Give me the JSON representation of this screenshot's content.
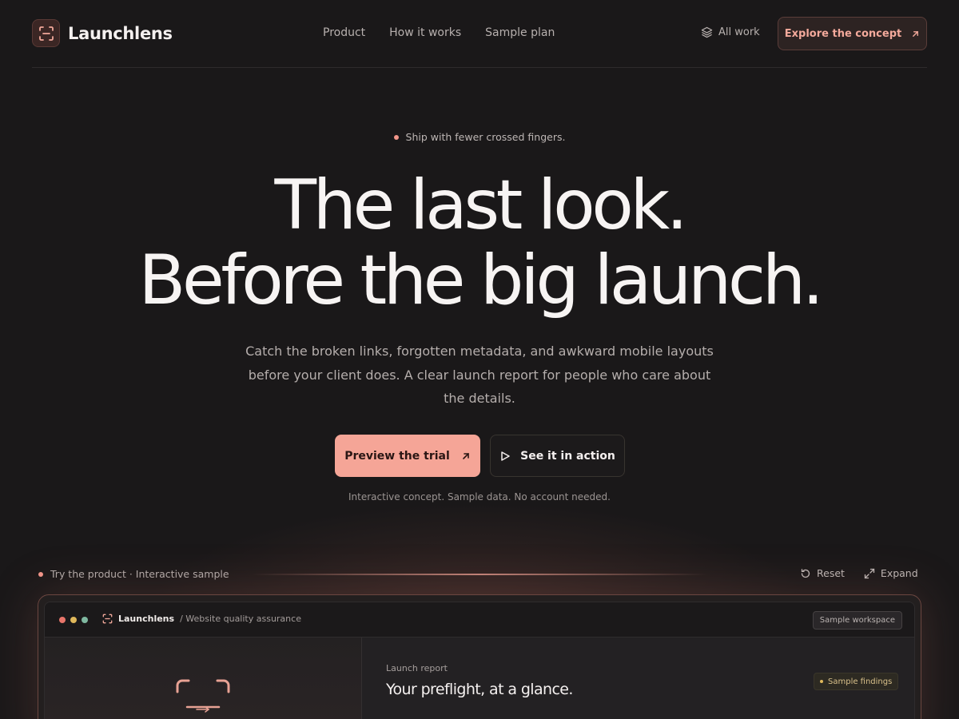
{
  "brand": {
    "name": "Launchlens"
  },
  "nav": {
    "links": [
      "Product",
      "How it works",
      "Sample plan"
    ],
    "all_work": "All work",
    "cta": "Explore the concept"
  },
  "hero": {
    "eyebrow": "Ship with fewer crossed fingers.",
    "headline_line1": "The last look.",
    "headline_line2": "Before the big launch.",
    "subheading": "Catch the broken links, forgotten metadata, and awkward mobile layouts before your client does. A clear launch report for people who care about the details.",
    "primary_button": "Preview the trial",
    "secondary_button": "See it in action",
    "fine_print": "Interactive concept. Sample data. No account needed."
  },
  "demo": {
    "label": "Try the product · Interactive sample",
    "reset": "Reset",
    "expand": "Expand"
  },
  "window": {
    "brand": "Launchlens",
    "subtitle": "/ Website quality assurance",
    "workspace": "Sample workspace",
    "report_label": "Launch report",
    "report_title": "Your preflight, at a glance.",
    "findings": "Sample findings"
  },
  "colors": {
    "accent": "#f5a597",
    "background": "#1a1819",
    "traffic_red": "#e8756a",
    "traffic_yellow": "#e0b85b",
    "traffic_green": "#7fb8a0"
  }
}
